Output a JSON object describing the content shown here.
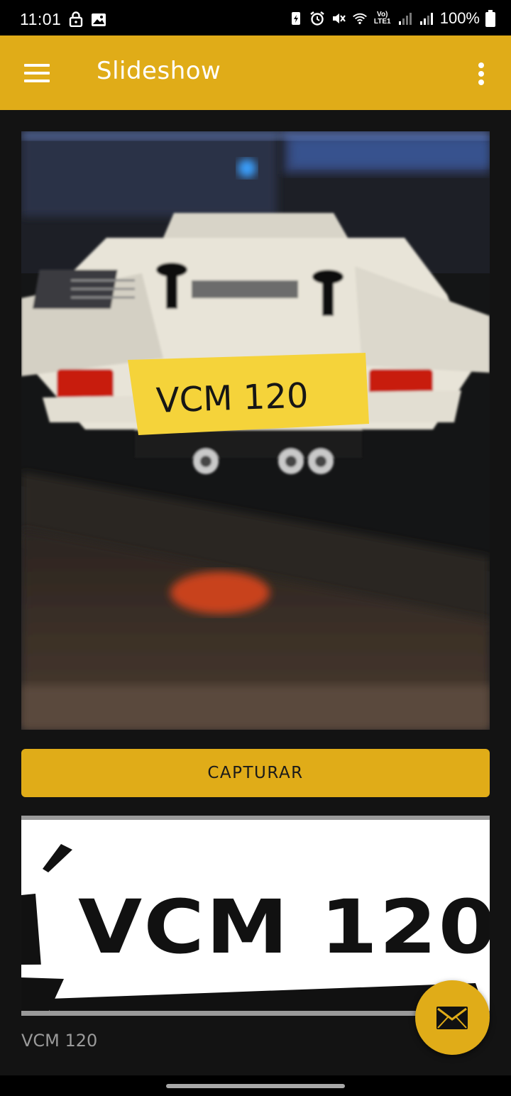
{
  "status_bar": {
    "time": "11:01",
    "network_label": "LTE1",
    "volte_label": "Vo)",
    "battery_percent": "100%"
  },
  "app_bar": {
    "title": "Slideshow",
    "background": "#e0ac18"
  },
  "camera_preview": {
    "plate_handwritten": "VCM 120"
  },
  "capture_button": {
    "label": "CAPTURAR"
  },
  "processed_plate": {
    "text": "VCM 120"
  },
  "result": {
    "text": "VCM 120"
  },
  "fab": {
    "icon": "mail-icon"
  },
  "colors": {
    "accent": "#e0ac18",
    "background": "#131313",
    "result_text": "#9a9a9a"
  }
}
